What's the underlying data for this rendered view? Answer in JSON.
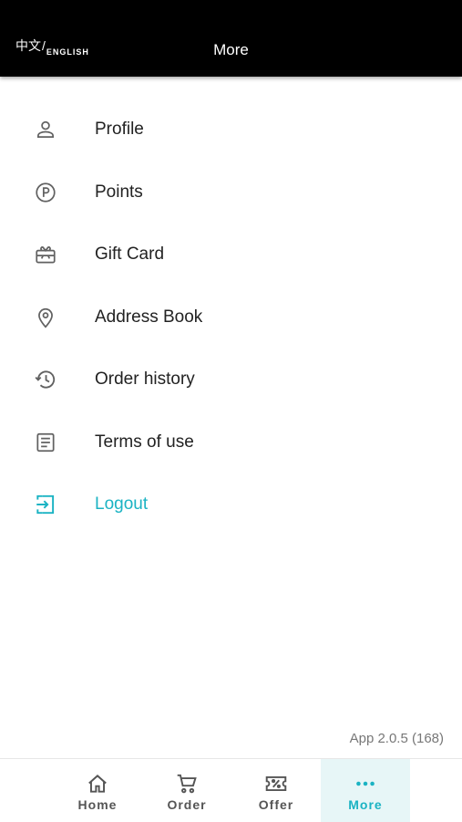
{
  "header": {
    "lang_zh": "中文",
    "lang_sep": "/",
    "lang_en": "ENGLISH",
    "title": "More"
  },
  "menu": {
    "items": [
      {
        "label": "Profile",
        "icon": "person-icon"
      },
      {
        "label": "Points",
        "icon": "points-icon"
      },
      {
        "label": "Gift Card",
        "icon": "gift-card-icon"
      },
      {
        "label": "Address Book",
        "icon": "location-pin-icon"
      },
      {
        "label": "Order history",
        "icon": "history-icon"
      },
      {
        "label": "Terms of use",
        "icon": "document-icon"
      },
      {
        "label": "Logout",
        "icon": "logout-icon"
      }
    ]
  },
  "version": "App 2.0.5 (168)",
  "bottom_nav": {
    "items": [
      {
        "label": "Home",
        "icon": "home-icon"
      },
      {
        "label": "Order",
        "icon": "cart-icon"
      },
      {
        "label": "Offer",
        "icon": "coupon-icon"
      },
      {
        "label": "More",
        "icon": "more-dots-icon",
        "active": true
      }
    ]
  },
  "colors": {
    "accent": "#1bb3c3",
    "header_bg": "#000000",
    "active_tab_bg": "#e7f6f7",
    "icon_gray": "#616161"
  }
}
